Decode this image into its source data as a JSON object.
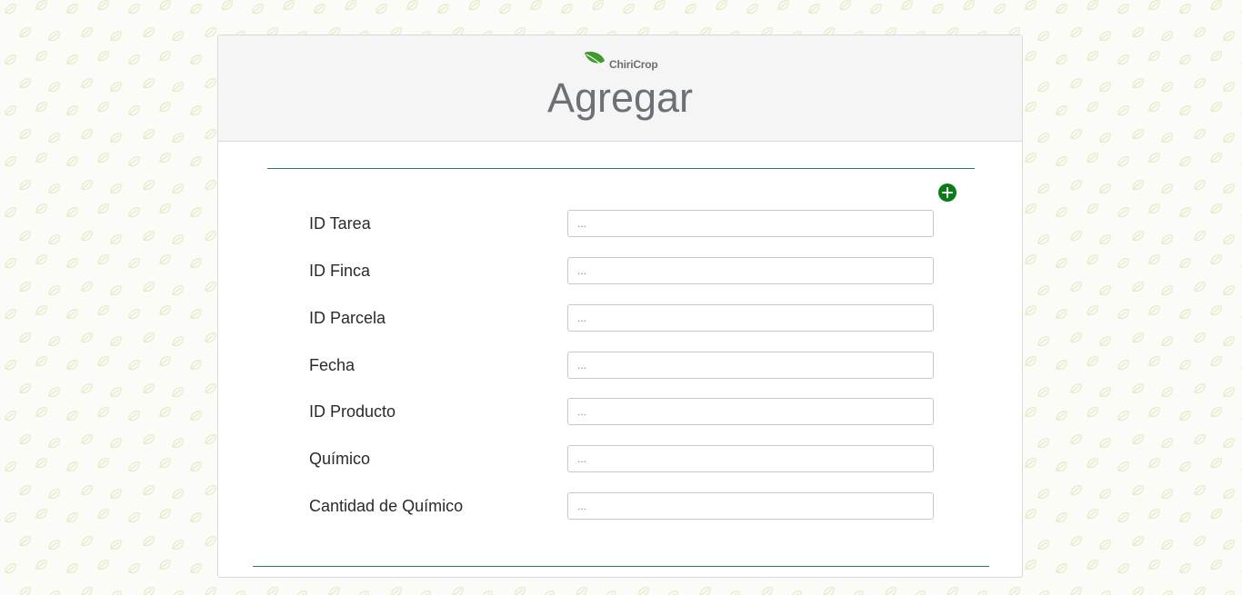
{
  "brand": {
    "name": "ChiriCrop",
    "accent_color": "#0a7d17",
    "logo_icon": "leaf-icon"
  },
  "header": {
    "title": "Agregar"
  },
  "actions": {
    "add_icon": "plus-circle-icon"
  },
  "form": {
    "fields": [
      {
        "label": "ID Tarea",
        "placeholder": "...",
        "value": ""
      },
      {
        "label": "ID Finca",
        "placeholder": "...",
        "value": ""
      },
      {
        "label": "ID Parcela",
        "placeholder": "...",
        "value": ""
      },
      {
        "label": "Fecha",
        "placeholder": "...",
        "value": ""
      },
      {
        "label": "ID Producto",
        "placeholder": "...",
        "value": ""
      },
      {
        "label": "Químico",
        "placeholder": "...",
        "value": ""
      },
      {
        "label": "Cantidad de Químico",
        "placeholder": "...",
        "value": ""
      }
    ]
  }
}
